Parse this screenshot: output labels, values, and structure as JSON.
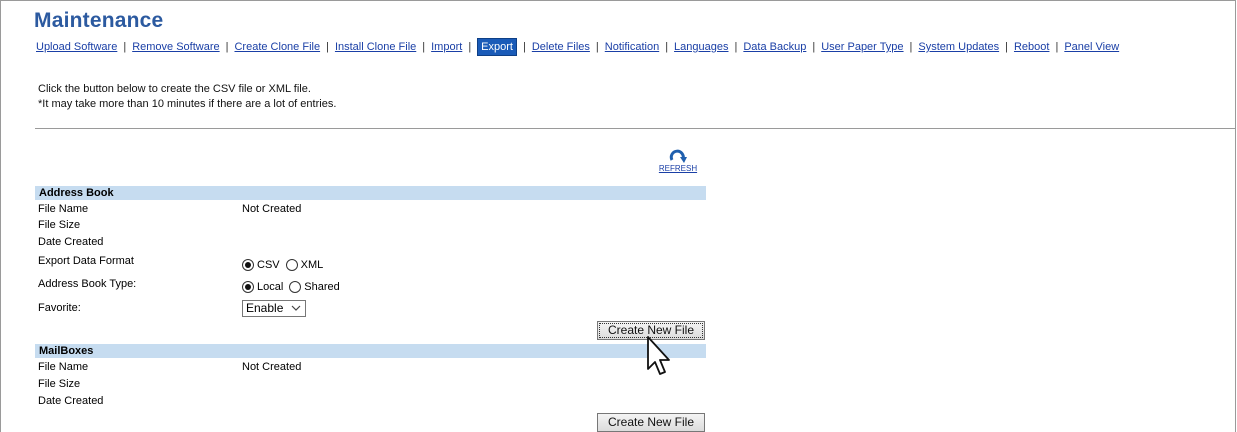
{
  "page": {
    "title": "Maintenance"
  },
  "nav": {
    "items": [
      {
        "label": "Upload Software",
        "active": false
      },
      {
        "label": "Remove Software",
        "active": false
      },
      {
        "label": "Create Clone File",
        "active": false
      },
      {
        "label": "Install Clone File",
        "active": false
      },
      {
        "label": "Import",
        "active": false
      },
      {
        "label": "Export",
        "active": true
      },
      {
        "label": "Delete Files",
        "active": false
      },
      {
        "label": "Notification",
        "active": false
      },
      {
        "label": "Languages",
        "active": false
      },
      {
        "label": "Data Backup",
        "active": false
      },
      {
        "label": "User Paper Type",
        "active": false
      },
      {
        "label": "System Updates",
        "active": false
      },
      {
        "label": "Reboot",
        "active": false
      },
      {
        "label": "Panel View",
        "active": false
      }
    ],
    "separator": "|"
  },
  "intro": {
    "line1": "Click the button below to create the CSV file or XML file.",
    "line2": "*It may take more than 10 minutes if there are a lot of entries."
  },
  "refresh": {
    "label": "REFRESH",
    "icon": "refresh-icon"
  },
  "address_book": {
    "heading": "Address Book",
    "file_name_label": "File Name",
    "file_name_value": "Not Created",
    "file_size_label": "File Size",
    "date_created_label": "Date Created",
    "export_format_label": "Export Data Format",
    "export_format_options": [
      {
        "label": "CSV",
        "selected": true
      },
      {
        "label": "XML",
        "selected": false
      }
    ],
    "book_type_label": "Address Book Type:",
    "book_type_options": [
      {
        "label": "Local",
        "selected": true
      },
      {
        "label": "Shared",
        "selected": false
      }
    ],
    "favorite_label": "Favorite:",
    "favorite_value": "Enable",
    "create_button": "Create New File"
  },
  "mailboxes": {
    "heading": "MailBoxes",
    "file_name_label": "File Name",
    "file_name_value": "Not Created",
    "file_size_label": "File Size",
    "date_created_label": "Date Created",
    "create_button": "Create New File"
  },
  "colors": {
    "title": "#2c5aa0",
    "link": "#1a3fa6",
    "active_tab": "#1a5bb8",
    "section_header": "#c6dcf0"
  }
}
